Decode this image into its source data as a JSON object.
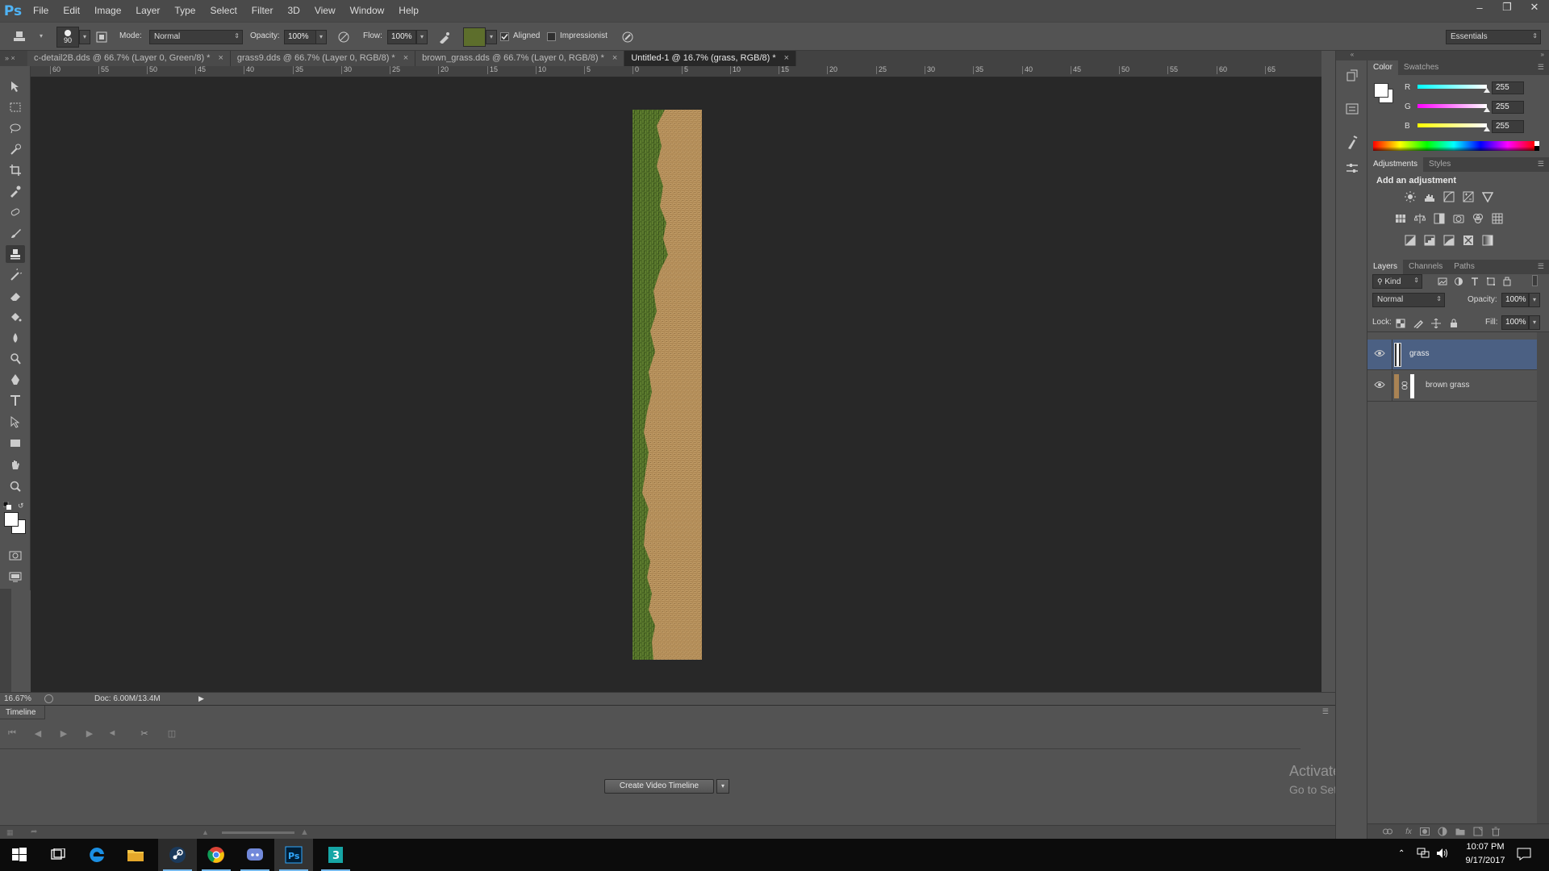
{
  "app": {
    "logo": "Ps",
    "menus": [
      "File",
      "Edit",
      "Image",
      "Layer",
      "Type",
      "Select",
      "Filter",
      "3D",
      "View",
      "Window",
      "Help"
    ]
  },
  "options_bar": {
    "brush_size": "90",
    "mode_label": "Mode:",
    "mode_value": "Normal",
    "opacity_label": "Opacity:",
    "opacity_value": "100%",
    "flow_label": "Flow:",
    "flow_value": "100%",
    "aligned_label": "Aligned",
    "aligned_checked": true,
    "impressionist_label": "Impressionist",
    "impressionist_checked": false,
    "workspace": "Essentials"
  },
  "tabs": [
    {
      "label": "c-detail2B.dds @ 66.7% (Layer 0, Green/8) *",
      "active": false
    },
    {
      "label": "grass9.dds @ 66.7% (Layer 0, RGB/8) *",
      "active": false
    },
    {
      "label": "brown_grass.dds @ 66.7% (Layer 0, RGB/8) *",
      "active": false
    },
    {
      "label": "Untitled-1 @ 16.7% (grass, RGB/8) *",
      "active": true
    }
  ],
  "ruler": {
    "ticks": [
      "60",
      "55",
      "50",
      "45",
      "40",
      "35",
      "30",
      "25",
      "20",
      "15",
      "10",
      "5",
      "0",
      "5",
      "10",
      "15",
      "20",
      "25",
      "30",
      "35",
      "40",
      "45",
      "50",
      "55",
      "60",
      "65"
    ]
  },
  "status": {
    "zoom": "16.67%",
    "doc": "Doc: 6.00M/13.4M"
  },
  "timeline": {
    "title": "Timeline",
    "create_button": "Create Video Timeline"
  },
  "color_panel": {
    "tabs": [
      "Color",
      "Swatches"
    ],
    "r_label": "R",
    "g_label": "G",
    "b_label": "B",
    "r": "255",
    "g": "255",
    "b": "255"
  },
  "adjustments_panel": {
    "tabs": [
      "Adjustments",
      "Styles"
    ],
    "heading": "Add an adjustment"
  },
  "layers_panel": {
    "tabs": [
      "Layers",
      "Channels",
      "Paths"
    ],
    "filter_kind": "Kind",
    "blend_mode": "Normal",
    "opacity_label": "Opacity:",
    "opacity_value": "100%",
    "lock_label": "Lock:",
    "fill_label": "Fill:",
    "fill_value": "100%",
    "layers": [
      {
        "name": "grass",
        "selected": true
      },
      {
        "name": "brown grass",
        "selected": false
      }
    ]
  },
  "watermark": {
    "title": "Activate Windows",
    "subtitle": "Go to Settings to activate Windows."
  },
  "taskbar": {
    "time": "10:07 PM",
    "date": "9/17/2017"
  },
  "colors": {
    "selected_layer": "#4b6083",
    "canvas_bg": "#282828",
    "panel_bg": "#535353",
    "ps_logo": "#4fb3f5"
  }
}
